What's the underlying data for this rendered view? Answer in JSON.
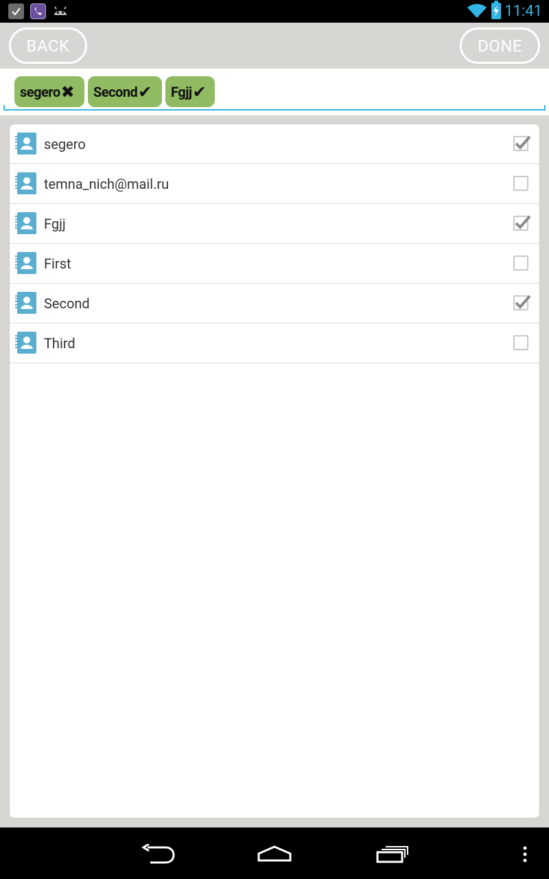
{
  "status_bar": {
    "time": "11:41",
    "left_icons": [
      "checkbox-notification-icon",
      "viber-icon",
      "android-debug-icon"
    ],
    "right_icons": [
      "wifi-icon",
      "battery-charging-icon"
    ]
  },
  "top_bar": {
    "back_label": "BACK",
    "done_label": "DONE"
  },
  "chips": [
    {
      "label": "segero",
      "mark": "✖"
    },
    {
      "label": "Second",
      "mark": "✔"
    },
    {
      "label": "Fgjj",
      "mark": "✔"
    }
  ],
  "contacts": [
    {
      "name": "segero",
      "checked": true
    },
    {
      "name": "temna_nich@mail.ru",
      "checked": false
    },
    {
      "name": "Fgjj",
      "checked": true
    },
    {
      "name": "First",
      "checked": false
    },
    {
      "name": "Second",
      "checked": true
    },
    {
      "name": "Third",
      "checked": false
    }
  ],
  "nav_bar": {
    "icons": [
      "back-icon",
      "home-icon",
      "recent-apps-icon",
      "overflow-menu-icon"
    ]
  },
  "colors": {
    "accent": "#33b5e5",
    "chip_green": "#90bb63",
    "contact_icon": "#5aaed0",
    "background": "#d7d6d2"
  }
}
